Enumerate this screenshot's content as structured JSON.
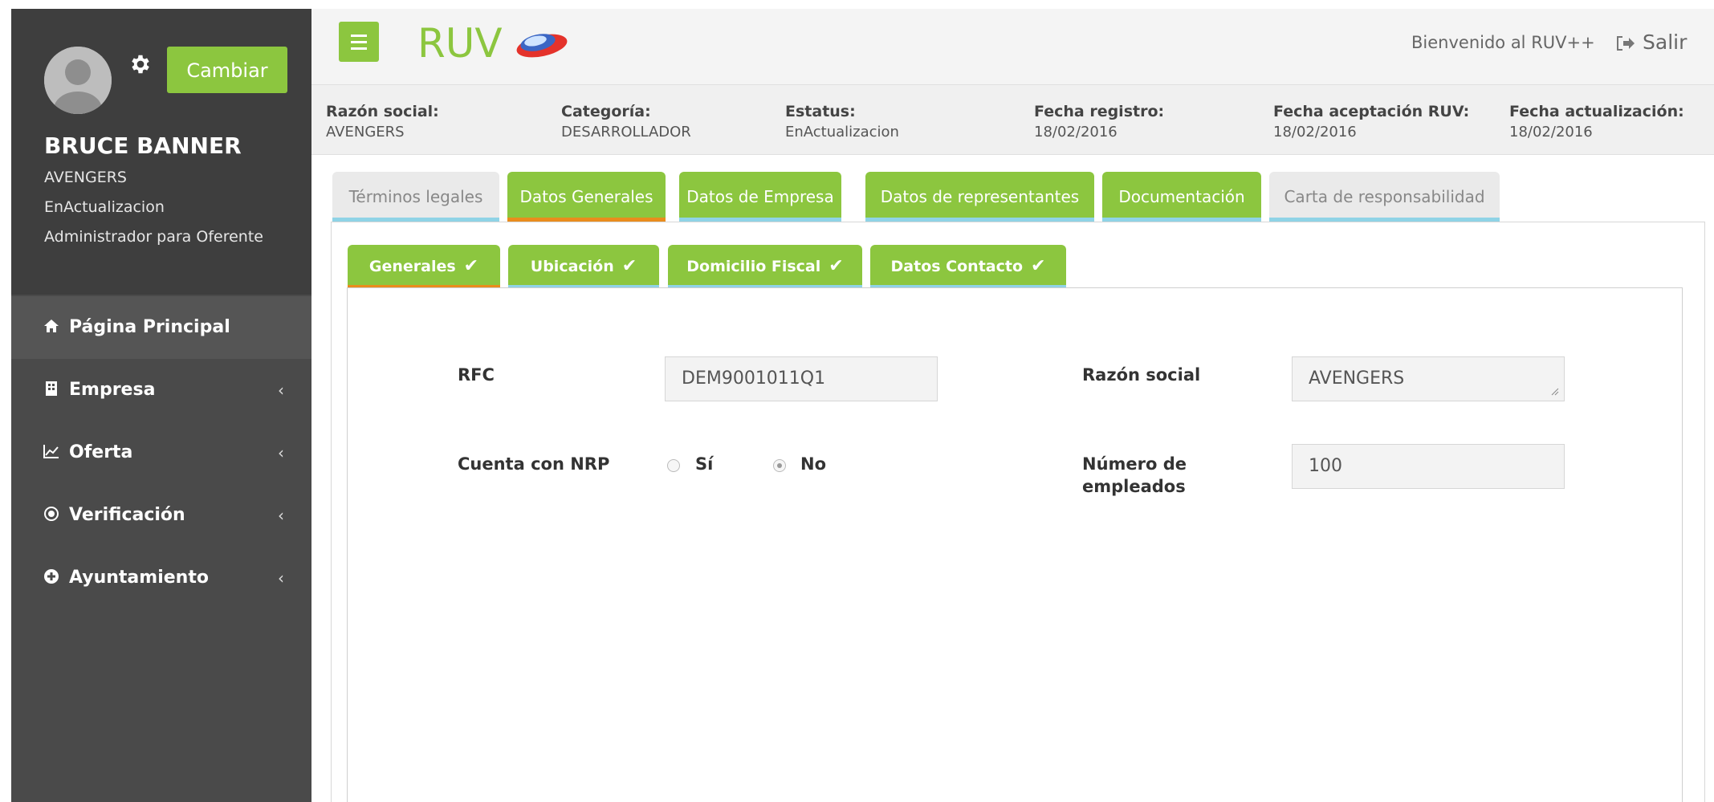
{
  "header": {
    "logo_text": "RUV",
    "welcome": "Bienvenido al RUV++",
    "logout": "Salir"
  },
  "sidebar": {
    "change_button": "Cambiar",
    "user_name": "BRUCE BANNER",
    "user_company": "AVENGERS",
    "user_status": "EnActualizacion",
    "user_role": "Administrador para Oferente",
    "menu": [
      {
        "label": "Página Principal",
        "icon": "home-icon"
      },
      {
        "label": "Empresa",
        "icon": "building-icon"
      },
      {
        "label": "Oferta",
        "icon": "chart-line-icon"
      },
      {
        "label": "Verificación",
        "icon": "target-icon"
      },
      {
        "label": "Ayuntamiento",
        "icon": "plus-circle-icon"
      }
    ],
    "chevron": "‹"
  },
  "info": {
    "razon_label": "Razón social:",
    "razon_value": "AVENGERS",
    "categoria_label": "Categoría:",
    "categoria_value": "DESARROLLADOR",
    "estatus_label": "Estatus:",
    "estatus_value": "EnActualizacion",
    "registro_label": "Fecha registro:",
    "registro_value": "18/02/2016",
    "aceptacion_label": "Fecha aceptación RUV:",
    "aceptacion_value": "18/02/2016",
    "actualizacion_label": "Fecha actualización:",
    "actualizacion_value": "18/02/2016"
  },
  "tabs": {
    "terminos": "Términos legales",
    "datos_generales": "Datos Generales",
    "datos_empresa": "Datos de Empresa",
    "datos_representantes": "Datos de representantes",
    "documentacion": "Documentación",
    "carta": "Carta de responsabilidad"
  },
  "subtabs": {
    "generales": "Generales",
    "ubicacion": "Ubicación",
    "domicilio": "Domicilio Fiscal",
    "contacto": "Datos Contacto",
    "check": "✔"
  },
  "form": {
    "rfc_label": "RFC",
    "rfc_value": "DEM9001011Q1",
    "razon_label": "Razón social",
    "razon_value": "AVENGERS",
    "nrp_label": "Cuenta con NRP",
    "nrp_yes": "Sí",
    "nrp_no": "No",
    "nrp_selected": "No",
    "empleados_label_1": "Número de",
    "empleados_label_2": "empleados",
    "empleados_value": "100"
  },
  "colors": {
    "accent_green": "#8cc63f",
    "sidebar_bg": "#4a4a4a",
    "tab_active_underline": "#e98c1d",
    "tab_underline": "#8fd3e6"
  }
}
